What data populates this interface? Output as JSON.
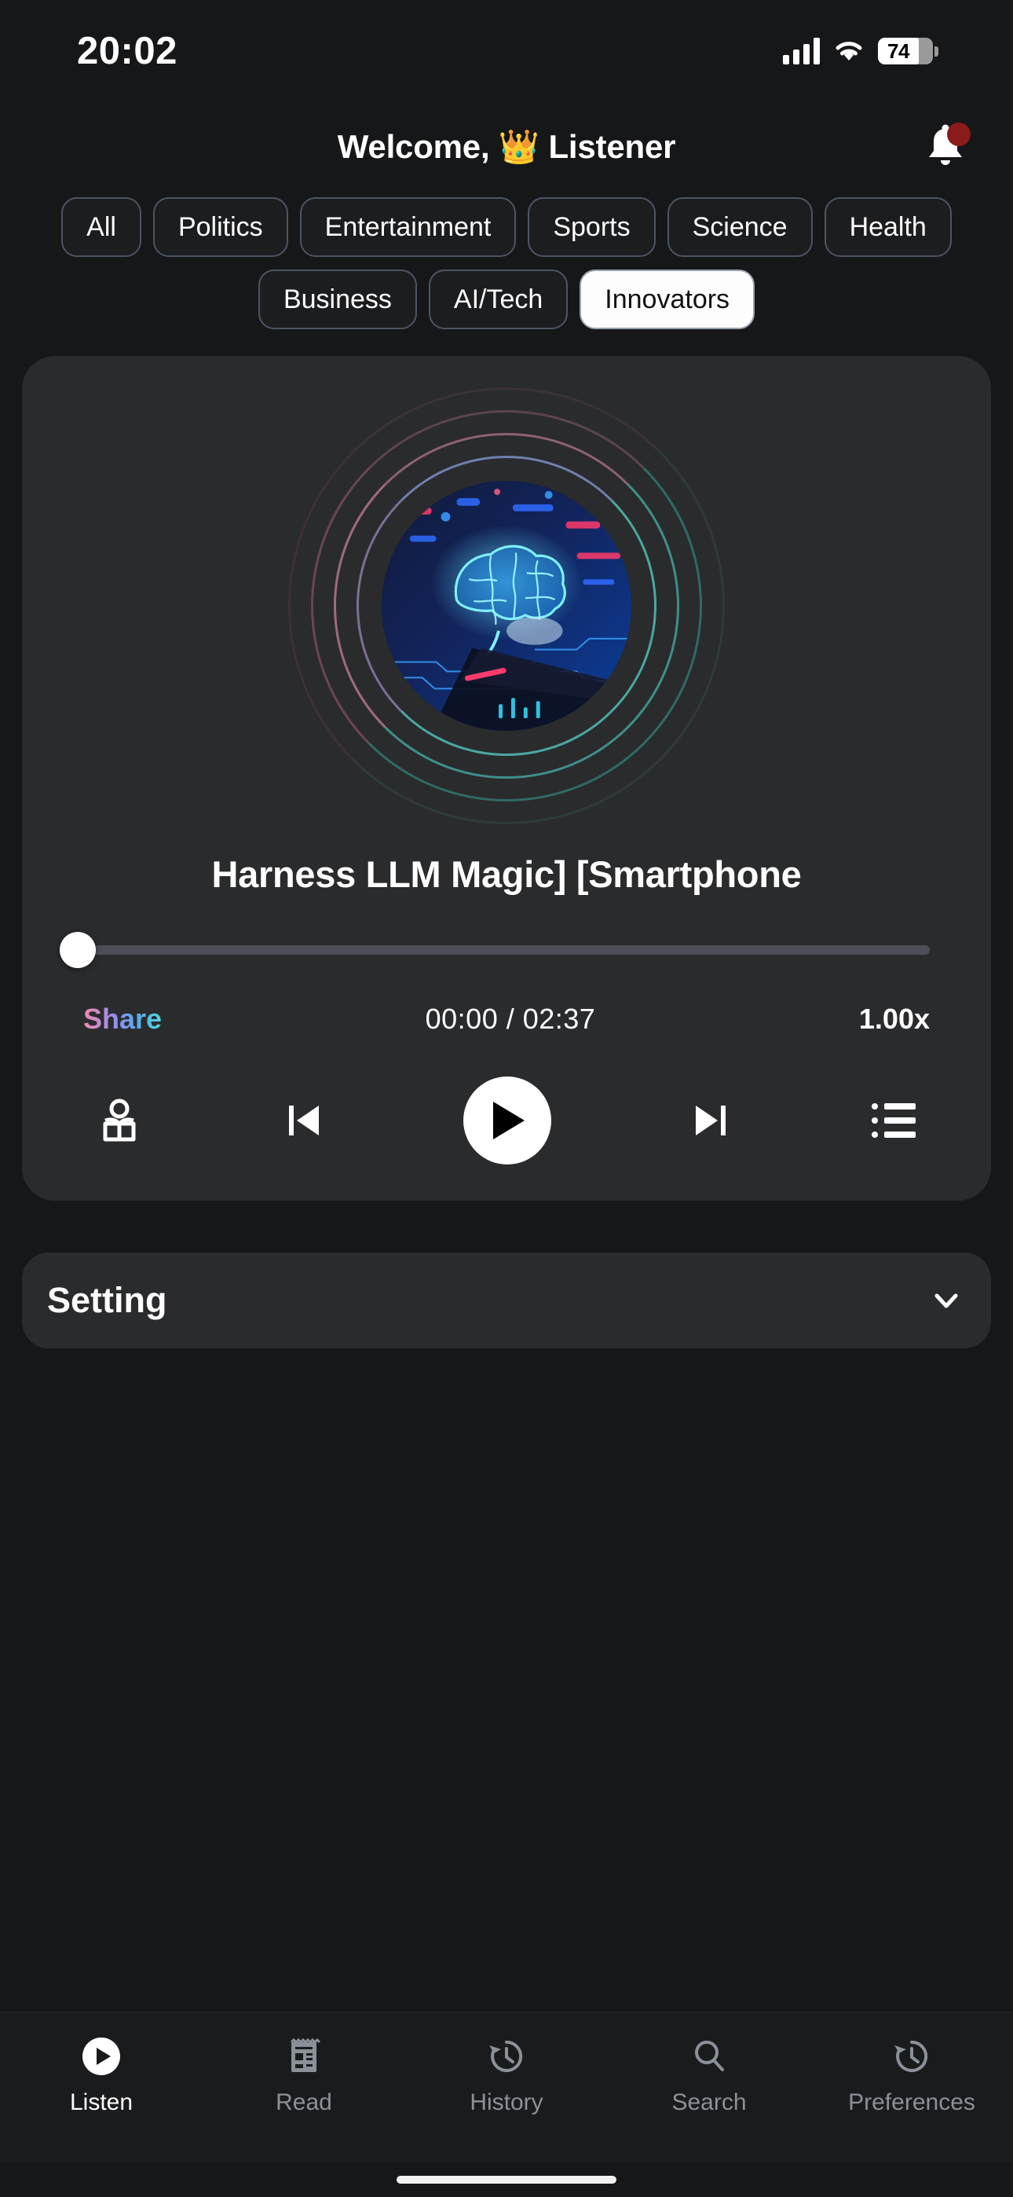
{
  "status_bar": {
    "time": "20:02",
    "battery_percent": "74",
    "icons": [
      "cellular-signal-icon",
      "wifi-icon",
      "battery-icon"
    ]
  },
  "header": {
    "greeting": "Welcome, 👑 Listener",
    "notification_icon": "bell-icon",
    "has_unread_badge": true
  },
  "categories": {
    "items": [
      {
        "label": "All",
        "selected": false
      },
      {
        "label": "Politics",
        "selected": false
      },
      {
        "label": "Entertainment",
        "selected": false
      },
      {
        "label": "Sports",
        "selected": false
      },
      {
        "label": "Science",
        "selected": false
      },
      {
        "label": "Health",
        "selected": false
      },
      {
        "label": "Business",
        "selected": false
      },
      {
        "label": "AI/Tech",
        "selected": false
      },
      {
        "label": "Innovators",
        "selected": true
      }
    ],
    "selected": "Innovators"
  },
  "player": {
    "artwork_alt": "glowing-blue-brain-on-smartphone-circuit-board",
    "track_title": "Harness LLM Magic]   [Smartphone",
    "progress_percent": 0,
    "elapsed": "00:00",
    "duration": "02:37",
    "timecode": "00:00 / 02:37",
    "share_label": "Share",
    "speed_label": "1.00x",
    "controls": [
      {
        "name": "narrator-icon",
        "label": "Narrator"
      },
      {
        "name": "previous-icon",
        "label": "Previous"
      },
      {
        "name": "play-icon",
        "label": "Play"
      },
      {
        "name": "next-icon",
        "label": "Next"
      },
      {
        "name": "playlist-icon",
        "label": "Queue"
      }
    ]
  },
  "setting_section": {
    "label": "Setting",
    "expand_icon": "chevron-down-icon",
    "expanded": false
  },
  "tabbar": {
    "items": [
      {
        "label": "Listen",
        "icon": "play-circle-icon",
        "active": true
      },
      {
        "label": "Read",
        "icon": "newspaper-icon",
        "active": false
      },
      {
        "label": "History",
        "icon": "clock-history-icon",
        "active": false
      },
      {
        "label": "Search",
        "icon": "search-icon",
        "active": false
      },
      {
        "label": "Preferences",
        "icon": "clock-history-icon",
        "active": false
      }
    ]
  },
  "colors": {
    "page_background": "#161719",
    "card_background": "#2a2b2d",
    "accent_white": "#ffffff",
    "chip_border": "#4b5563",
    "badge_red": "#8B1A1A",
    "track_inactive": "#4e4e58",
    "tab_inactive": "#8b9198"
  }
}
